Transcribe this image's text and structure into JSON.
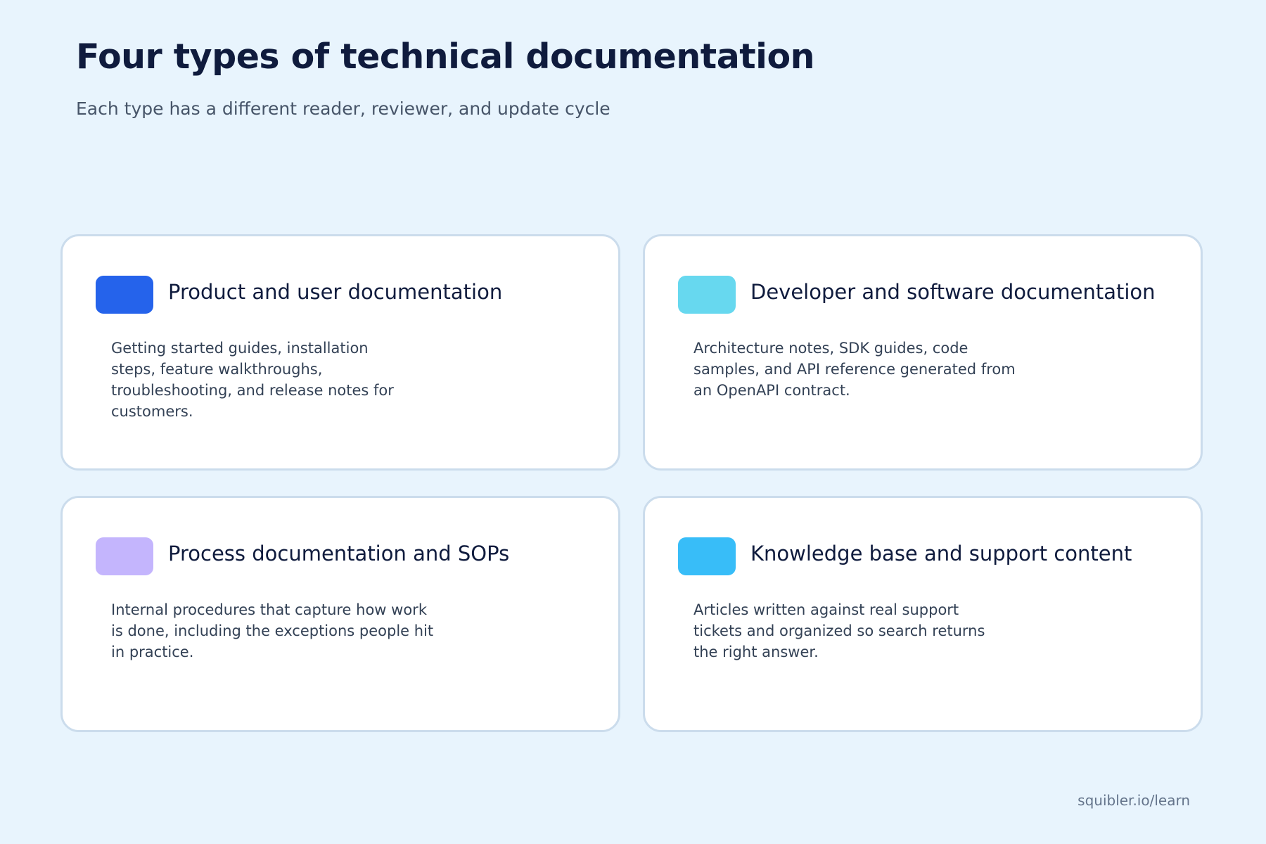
{
  "header": {
    "title": "Four types of technical documentation",
    "subtitle": "Each type has a different reader, reviewer, and update cycle"
  },
  "cards": [
    {
      "title": "Product and user documentation",
      "description": "Getting started guides, installation steps, feature walkthroughs, troubleshooting, and release notes for customers.",
      "color": "#2563eb"
    },
    {
      "title": "Developer and software documentation",
      "description": "Architecture notes, SDK guides, code samples, and API reference generated from an OpenAPI contract.",
      "color": "#67d8ef"
    },
    {
      "title": "Process documentation and SOPs",
      "description": "Internal procedures that capture how work is done, including the exceptions people hit in practice.",
      "color": "#c4b5fd"
    },
    {
      "title": "Knowledge base and support content",
      "description": "Articles written against real support tickets and organized so search returns the right answer.",
      "color": "#38bdf8"
    }
  ],
  "footer": {
    "source": "squibler.io/learn"
  }
}
